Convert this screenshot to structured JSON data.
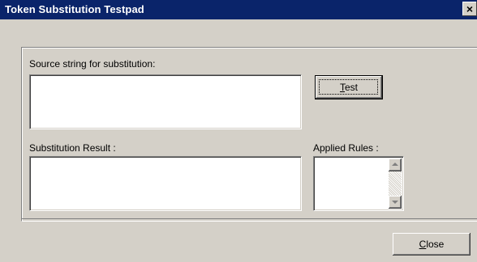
{
  "window": {
    "title": "Token Substitution Testpad",
    "close_glyph": "×"
  },
  "source": {
    "label": "Source string for substitution:",
    "value": ""
  },
  "test_button": {
    "label_mnemonic": "T",
    "label_rest": "est"
  },
  "result": {
    "label": "Substitution Result :",
    "value": ""
  },
  "rules": {
    "label": "Applied Rules :",
    "items": []
  },
  "close_button": {
    "label_mnemonic": "C",
    "label_rest": "lose"
  }
}
